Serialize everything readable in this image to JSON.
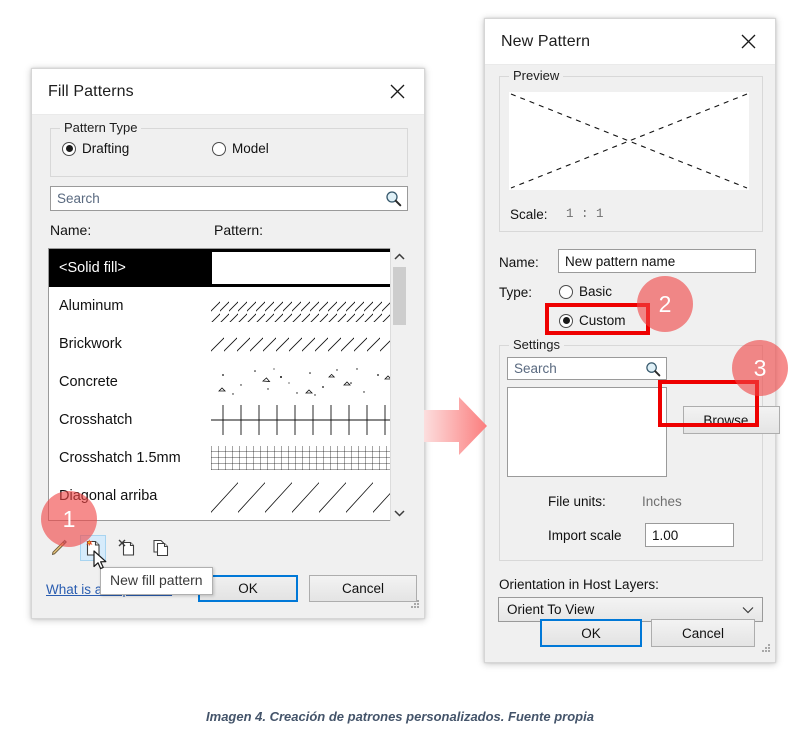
{
  "caption": "Imagen 4. Creación de patrones personalizados. Fuente propia",
  "fill_patterns_dialog": {
    "title": "Fill Patterns",
    "close_icon": "close-x-icon",
    "pattern_type": {
      "legend": "Pattern Type",
      "options": [
        {
          "label": "Drafting",
          "checked": true
        },
        {
          "label": "Model",
          "checked": false
        }
      ]
    },
    "search": {
      "placeholder": "Search",
      "value": "",
      "icon": "magnifier-icon"
    },
    "columns": {
      "name": "Name:",
      "pattern": "Pattern:"
    },
    "patterns": [
      {
        "name": "<Solid fill>",
        "swatch": "solid",
        "selected": true
      },
      {
        "name": "Aluminum",
        "swatch": "diagonal-dense",
        "selected": false
      },
      {
        "name": "Brickwork",
        "swatch": "diagonal-medium",
        "selected": false
      },
      {
        "name": "Concrete",
        "swatch": "speckle",
        "selected": false
      },
      {
        "name": "Crosshatch",
        "swatch": "grid-coarse",
        "selected": false
      },
      {
        "name": "Crosshatch 1.5mm",
        "swatch": "grid-fine",
        "selected": false
      },
      {
        "name": "Diagonal arriba",
        "swatch": "diagonal-sparse",
        "selected": false
      }
    ],
    "toolbar": [
      {
        "name": "edit-pattern",
        "icon": "pencil-icon",
        "hover": false
      },
      {
        "name": "new-fill-pattern",
        "icon": "new-page-icon",
        "hover": true
      },
      {
        "name": "delete-pattern",
        "icon": "delete-page-icon",
        "hover": false
      },
      {
        "name": "duplicate-pattern",
        "icon": "copy-page-icon",
        "hover": false
      }
    ],
    "tooltip": "New fill pattern",
    "help_link": "What is a fill pattern?",
    "ok_label": "OK",
    "cancel_label": "Cancel"
  },
  "new_pattern_dialog": {
    "title": "New Pattern",
    "close_icon": "close-x-icon",
    "preview": {
      "legend": "Preview",
      "scale_label": "Scale:",
      "scale_value": "1 : 1"
    },
    "name_label": "Name:",
    "name_value": "New pattern name",
    "type_label": "Type:",
    "type_options": [
      {
        "label": "Basic",
        "checked": false
      },
      {
        "label": "Custom",
        "checked": true
      }
    ],
    "settings": {
      "legend": "Settings",
      "search": {
        "placeholder": "Search",
        "value": "",
        "icon": "magnifier-icon"
      },
      "file_list": [],
      "browse_label": "Browse...",
      "file_units_label": "File units:",
      "file_units_value": "Inches",
      "import_scale_label": "Import scale",
      "import_scale_value": "1.00"
    },
    "orientation_label": "Orientation in Host Layers:",
    "orientation_value": "Orient To View",
    "ok_label": "OK",
    "cancel_label": "Cancel"
  },
  "annotations": {
    "badges": [
      {
        "number": "1"
      },
      {
        "number": "2"
      },
      {
        "number": "3"
      }
    ],
    "badge_color": "#f04646",
    "highlight_color": "#ee0000",
    "arrow_color": "#fb8080"
  }
}
